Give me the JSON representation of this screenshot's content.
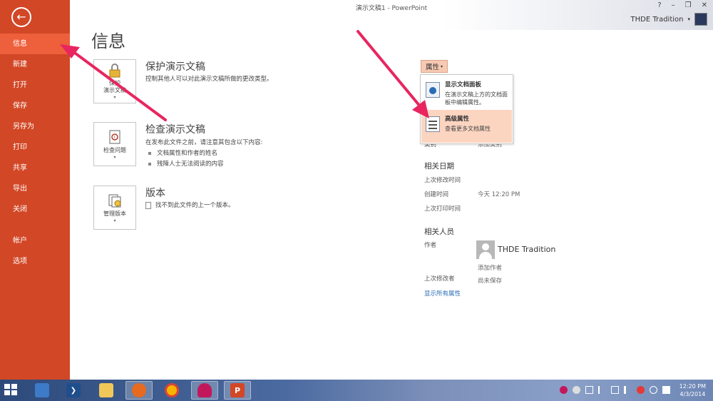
{
  "window": {
    "title": "演示文稿1 - PowerPoint",
    "controls": [
      "?",
      "–",
      "❐",
      "✕"
    ],
    "user_name": "THDE Tradition"
  },
  "sidebar": {
    "back_icon": "arrow-left-icon",
    "items": [
      {
        "label": "信息",
        "active": true
      },
      {
        "label": "新建"
      },
      {
        "label": "打开"
      },
      {
        "label": "保存"
      },
      {
        "label": "另存为"
      },
      {
        "label": "打印"
      },
      {
        "label": "共享"
      },
      {
        "label": "导出"
      },
      {
        "label": "关闭"
      }
    ],
    "bottom_items": [
      {
        "label": "帐户"
      },
      {
        "label": "选项"
      }
    ]
  },
  "main": {
    "page_title": "信息",
    "protect": {
      "button_label": "保护\n演示文稿",
      "title": "保护演示文稿",
      "desc": "控制其他人可以对此演示文稿所做的更改类型。"
    },
    "inspect": {
      "button_label": "检查问题",
      "title": "检查演示文稿",
      "desc": "在发布此文件之前，请注意其包含以下内容:",
      "bullets": [
        "文档属性和作者的姓名",
        "残障人士无法阅读的内容"
      ]
    },
    "versions": {
      "button_label": "管理版本",
      "title": "版本",
      "desc": "找不到此文件的上一个版本。"
    }
  },
  "properties": {
    "button_label": "属性",
    "menu": [
      {
        "title": "显示文档面板",
        "desc": "在演示文稿上方的文档面板中编辑属性。"
      },
      {
        "title": "高级属性",
        "desc": "查看更多文档属性"
      }
    ],
    "hidden_row_label": "类别",
    "hidden_row_value": "添加类别",
    "dates_heading": "相关日期",
    "dates": [
      {
        "label": "上次修改时间",
        "value": ""
      },
      {
        "label": "创建时间",
        "value": "今天 12:20 PM"
      },
      {
        "label": "上次打印时间",
        "value": ""
      }
    ],
    "people_heading": "相关人员",
    "author_label": "作者",
    "author_name": "THDE Tradition",
    "add_author": "添加作者",
    "last_modified_by_label": "上次修改者",
    "last_modified_by_value": "尚未保存",
    "show_all": "显示所有属性"
  },
  "taskbar": {
    "apps": [
      "server-manager-icon",
      "powershell-icon",
      "file-explorer-icon",
      "firefox-icon",
      "chrome-icon",
      "heart-app-icon",
      "powerpoint-icon"
    ],
    "time": "12:20 PM",
    "date": "4/3/2014"
  },
  "colors": {
    "accent": "#d24726",
    "accent_active": "#ee5f3b",
    "arrow": "#e8255f"
  }
}
